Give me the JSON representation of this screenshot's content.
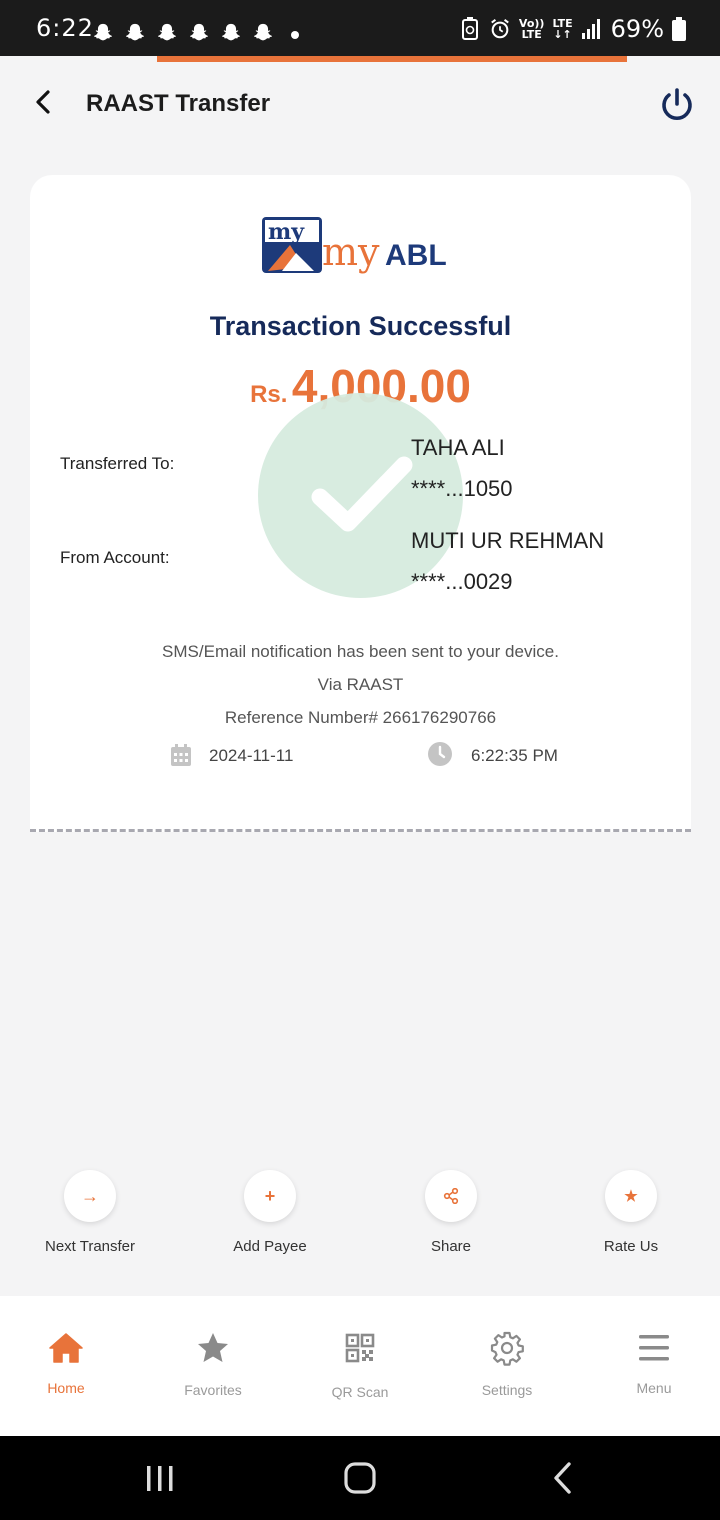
{
  "status_bar": {
    "time": "6:22",
    "volte": "Vo))",
    "lte_top": "LTE",
    "lte_bottom": "LTE",
    "battery": "69%"
  },
  "header": {
    "title": "RAAST Transfer"
  },
  "receipt": {
    "logo_text": "myABL",
    "title": "Transaction Successful",
    "currency": "Rs.",
    "amount": "4,000.00",
    "transferred_to_label": "Transferred To:",
    "transferred_to_name": "TAHA ALI",
    "transferred_to_account": "****...1050",
    "from_account_label": "From Account:",
    "from_account_name": "MUTI UR REHMAN",
    "from_account_number": "****...0029",
    "notification": "SMS/Email notification has been sent to your device.",
    "via": "Via RAAST",
    "reference": "Reference Number# 266176290766",
    "date": "2024-11-11",
    "time": "6:22:35 PM"
  },
  "actions": [
    {
      "label": "Next Transfer",
      "icon": "arrow-right-icon",
      "glyph": "→"
    },
    {
      "label": "Add Payee",
      "icon": "plus-icon",
      "glyph": "+"
    },
    {
      "label": "Share",
      "icon": "share-icon",
      "glyph": ""
    },
    {
      "label": "Rate Us",
      "icon": "star-icon",
      "glyph": "★"
    }
  ],
  "bottom_nav": [
    {
      "label": "Home",
      "icon": "home-icon",
      "active": true
    },
    {
      "label": "Favorites",
      "icon": "star-icon",
      "active": false
    },
    {
      "label": "QR Scan",
      "icon": "qr-code-icon",
      "active": false
    },
    {
      "label": "Settings",
      "icon": "gear-icon",
      "active": false
    },
    {
      "label": "Menu",
      "icon": "hamburger-menu-icon",
      "active": false
    }
  ],
  "colors": {
    "accent": "#e8733a",
    "title_navy": "#162a5a",
    "success_circle": "#d6ebdf"
  }
}
